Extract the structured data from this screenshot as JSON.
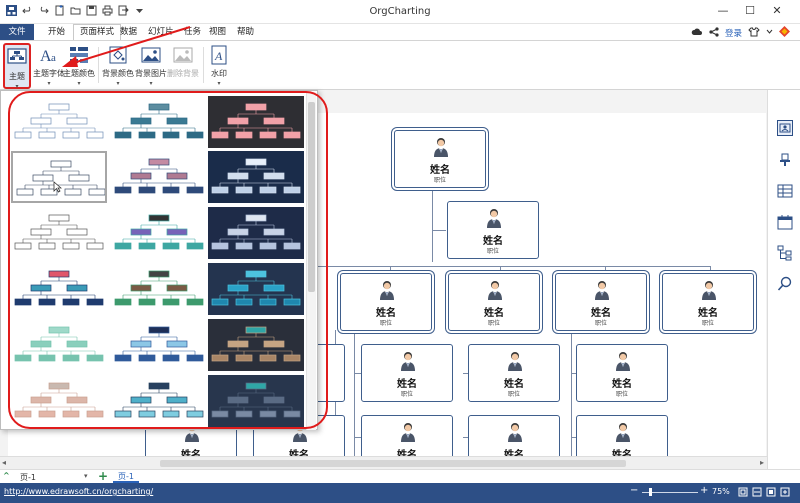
{
  "window": {
    "title": "OrgCharting",
    "controls": [
      "—",
      "☐",
      "✕"
    ]
  },
  "menu": {
    "tabs": [
      "文件",
      "开始",
      "页面样式",
      "数据",
      "幻灯片",
      "任务",
      "视图",
      "帮助"
    ],
    "active_tab": "页面样式",
    "login_label": "登录"
  },
  "ribbon": {
    "buttons": [
      {
        "label": "主题"
      },
      {
        "label": "主题字体"
      },
      {
        "label": "主题颜色"
      },
      {
        "label": "背景颜色"
      },
      {
        "label": "背景图片"
      },
      {
        "label": "删除背景"
      },
      {
        "label": "水印"
      }
    ]
  },
  "theme_gallery": {
    "selected_index": 3,
    "themes": [
      {
        "style": "outline-light",
        "bg": "#ffffff",
        "top": "#ffffff",
        "mid": "#ffffff",
        "low": "#ffffff",
        "stroke": "#6f8db5"
      },
      {
        "style": "teal",
        "bg": "#ffffff",
        "top": "#5c8da0",
        "mid": "#3a7a93",
        "low": "#2d6a85",
        "stroke": "#2d6a85"
      },
      {
        "style": "dark-pink",
        "bg": "#2e2e33",
        "top": "#f1a1a8",
        "mid": "#f1a1a8",
        "low": "#f1a1a8",
        "stroke": "#f1a1a8"
      },
      {
        "style": "outline-selected",
        "bg": "#ffffff",
        "top": "#ffffff",
        "mid": "#ffffff",
        "low": "#ffffff",
        "stroke": "#3b4a64"
      },
      {
        "style": "mauve-navy",
        "bg": "#ffffff",
        "top": "#c48aa2",
        "mid": "#b07a92",
        "low": "#2e4a7a",
        "stroke": "#2e4a7a"
      },
      {
        "style": "dark-blue",
        "bg": "#1a2c4a",
        "top": "#e8f0fa",
        "mid": "#d2deee",
        "low": "#bfd1e8",
        "stroke": "#d2deee"
      },
      {
        "style": "outline-gray",
        "bg": "#ffffff",
        "top": "#ffffff",
        "mid": "#ffffff",
        "low": "#ffffff",
        "stroke": "#555555"
      },
      {
        "style": "purple-teal",
        "bg": "#ffffff",
        "top": "#333333",
        "mid": "#7763b8",
        "low": "#3ea7a2",
        "stroke": "#3ea7a2"
      },
      {
        "style": "navy-dark",
        "bg": "#1e2b48",
        "top": "#dfe6f1",
        "mid": "#c9d3e6",
        "low": "#b5c3dd",
        "stroke": "#b5c3dd"
      },
      {
        "style": "red-navy",
        "bg": "#ffffff",
        "top": "#e0566b",
        "mid": "#3b9bb7",
        "low": "#1f3b6e",
        "stroke": "#1f3b6e"
      },
      {
        "style": "brown-gold",
        "bg": "#ffffff",
        "top": "#444444",
        "mid": "#7a5a45",
        "low": "#3d9a6d",
        "stroke": "#3d9a6d"
      },
      {
        "style": "dark-cyan",
        "bg": "#24344f",
        "top": "#4dc2de",
        "mid": "#2aa2c7",
        "low": "#1f87ae",
        "stroke": "#4dc2de"
      },
      {
        "style": "mint",
        "bg": "#ffffff",
        "top": "#9fd9c9",
        "mid": "#8acfbc",
        "low": "#76c3ae",
        "stroke": "#76c3ae"
      },
      {
        "style": "navy-sky",
        "bg": "#ffffff",
        "top": "#1f2f57",
        "mid": "#8cc7e6",
        "low": "#2f5a9a",
        "stroke": "#2f5a9a"
      },
      {
        "style": "dark-tan",
        "bg": "#2a2f3a",
        "top": "#2fa6a7",
        "mid": "#c5a483",
        "low": "#a88566",
        "stroke": "#c5a483"
      },
      {
        "style": "beige-pink",
        "bg": "#ffffff",
        "top": "#c9b9b0",
        "mid": "#dcb6a9",
        "low": "#e3b6a8",
        "stroke": "#c9a091"
      },
      {
        "style": "navy-aqua",
        "bg": "#ffffff",
        "top": "#27405f",
        "mid": "#4fb0c9",
        "low": "#7fcde0",
        "stroke": "#27405f"
      },
      {
        "style": "dark-slate",
        "bg": "#28364d",
        "top": "#2fa6a7",
        "mid": "#5a6b84",
        "low": "#7a8aa3",
        "stroke": "#5a6b84"
      }
    ]
  },
  "org_chart": {
    "name_label": "姓名",
    "position_label": "职位"
  },
  "page_tabs": {
    "tabs": [
      "页-1",
      "页-1"
    ],
    "add_label": "+"
  },
  "status": {
    "url": "http://www.edrawsoft.cn/orgcharting/",
    "zoom": "75%"
  }
}
